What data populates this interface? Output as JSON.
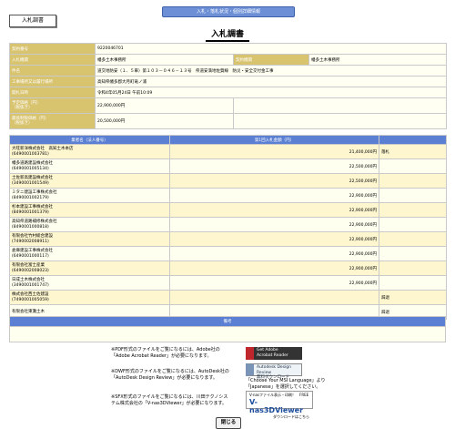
{
  "header": {
    "top_bar": "入札・落札状況・個別詳細情報",
    "tag": "入札調書",
    "page_title": "入札調書"
  },
  "info_rows": [
    {
      "label": "契約番号",
      "value": "9220046701"
    },
    {
      "label": "入札機関",
      "value": "幡多土木事務所",
      "label2": "契約機関",
      "value2": "幡多土木事務所"
    },
    {
      "label": "件名",
      "value": "道交地防安（１．５車）第１０３－０４６－１３号　県道安満地佐賀線　防災・安全交付金工事"
    },
    {
      "label": "工事場所又は履行場所",
      "value": "高知県幡多郡大月町竜ノ浦"
    },
    {
      "label": "開札日時",
      "value": "令和4年05月24日 午前10:09"
    },
    {
      "label": "予定価格（円）\n（税抜き）",
      "value": "22,900,000円"
    },
    {
      "label": "最低制限価格（円）\n（税抜き）",
      "value": "20,500,000円"
    }
  ],
  "results": {
    "headers": [
      "業者名（法人番号）",
      "第1回入札金額（円）",
      ""
    ],
    "rows": [
      {
        "name": "大旺新洋株式会社　高知土木本店\n(6490001003781)",
        "amount": "21,400,000円",
        "status": "落札"
      },
      {
        "name": "幡多道路建設株式会社\n(6490001005134)",
        "amount": "22,500,000円",
        "status": ""
      },
      {
        "name": "土佐新高建設株式会社\n(3490001001549)",
        "amount": "22,500,000円",
        "status": ""
      },
      {
        "name": "ミタニ建設工事株式会社\n(8490001002179)",
        "amount": "22,900,000円",
        "status": ""
      },
      {
        "name": "杉本建設工事株式会社\n(8490001001379)",
        "amount": "22,900,000円",
        "status": ""
      },
      {
        "name": "高知県道路補修株式会社\n(8490001000818)",
        "amount": "22,900,000円",
        "status": ""
      },
      {
        "name": "有限会社竹村総合建設\n(7490002008911)",
        "amount": "22,900,000円",
        "status": ""
      },
      {
        "name": "倉庫建設工事株式会社\n(6490001000117)",
        "amount": "22,900,000円",
        "status": ""
      },
      {
        "name": "有限会社富士産業\n(6490002008023)",
        "amount": "22,900,000円",
        "status": ""
      },
      {
        "name": "日成土木株式会社\n(3490001001747)",
        "amount": "22,900,000円",
        "status": ""
      },
      {
        "name": "株式会社西土佐建設\n(7490001005059)",
        "amount": "",
        "status": "辞退"
      },
      {
        "name": "有限会社東灘土木",
        "amount": "",
        "status": "辞退"
      }
    ]
  },
  "remarks": {
    "header": "備考",
    "content": ""
  },
  "footer": {
    "pdf_note": "※PDF形式のファイルをご覧になるには、Adobe社の\n「Adobe Acrobat Reader」が必要になります。",
    "dwf_note": "※DWF形式のファイルをご覧になるには、AutoDesk社の\n「AutoDesk Design Review」が必要になります。",
    "dwf_note2": "「Choose Your MSI Language」より\n「Japanese」を選択してください。",
    "sfx_note": "※SFX形式のファイルをご覧になるには、川田テクノシス\nテム株式会社の「V-nas3DViewer」が必要になります。",
    "badge_adobe": "Get Adobe\nAcrobat Reader",
    "badge_autodesk": "Autodesk Design Review\n無料ダウンロード",
    "badge_vnas_top": "V-nasファイル表示・印刷！　FREE",
    "badge_vnas_main": "V-nas3DViewer",
    "badge_vnas_sub": "ダウンロードはこちら",
    "close_label": "閉じる"
  }
}
